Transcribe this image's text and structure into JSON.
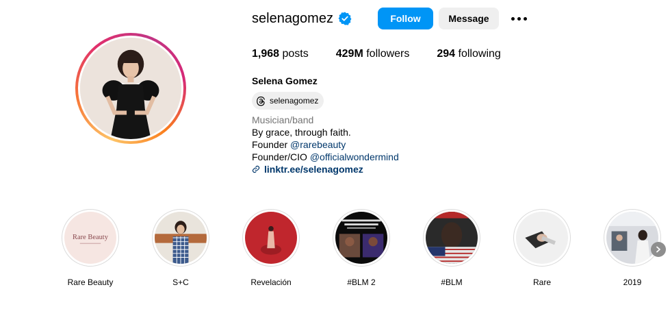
{
  "profile": {
    "username": "selenagomez",
    "verified": true,
    "follow_label": "Follow",
    "message_label": "Message",
    "stats": {
      "posts_count": "1,968",
      "posts_label": "posts",
      "followers_count": "429M",
      "followers_label": "followers",
      "following_count": "294",
      "following_label": "following"
    },
    "full_name": "Selena Gomez",
    "threads_handle": "selenagomez",
    "bio": {
      "category": "Musician/band",
      "line1": "By grace, through faith.",
      "line2_prefix": "Founder ",
      "line2_mention": "@rarebeauty",
      "line3_prefix": "Founder/CIO ",
      "line3_mention": "@officialwondermind",
      "link": "linktr.ee/selenagomez"
    }
  },
  "highlights": [
    {
      "label": "Rare Beauty",
      "cover_text": "Rare Beauty"
    },
    {
      "label": "S+C"
    },
    {
      "label": "Revelación"
    },
    {
      "label": "#BLM 2"
    },
    {
      "label": "#BLM"
    },
    {
      "label": "Rare"
    },
    {
      "label": "2019"
    }
  ],
  "colors": {
    "follow_button": "#0095f6",
    "message_button": "#efefef",
    "verified_badge": "#0095f6",
    "link_text": "#00376b",
    "category_text": "#737373"
  },
  "icons": {
    "verified": "verified-badge-icon",
    "more": "more-options-icon",
    "threads": "threads-icon",
    "link": "link-icon",
    "next": "chevron-right-icon"
  }
}
